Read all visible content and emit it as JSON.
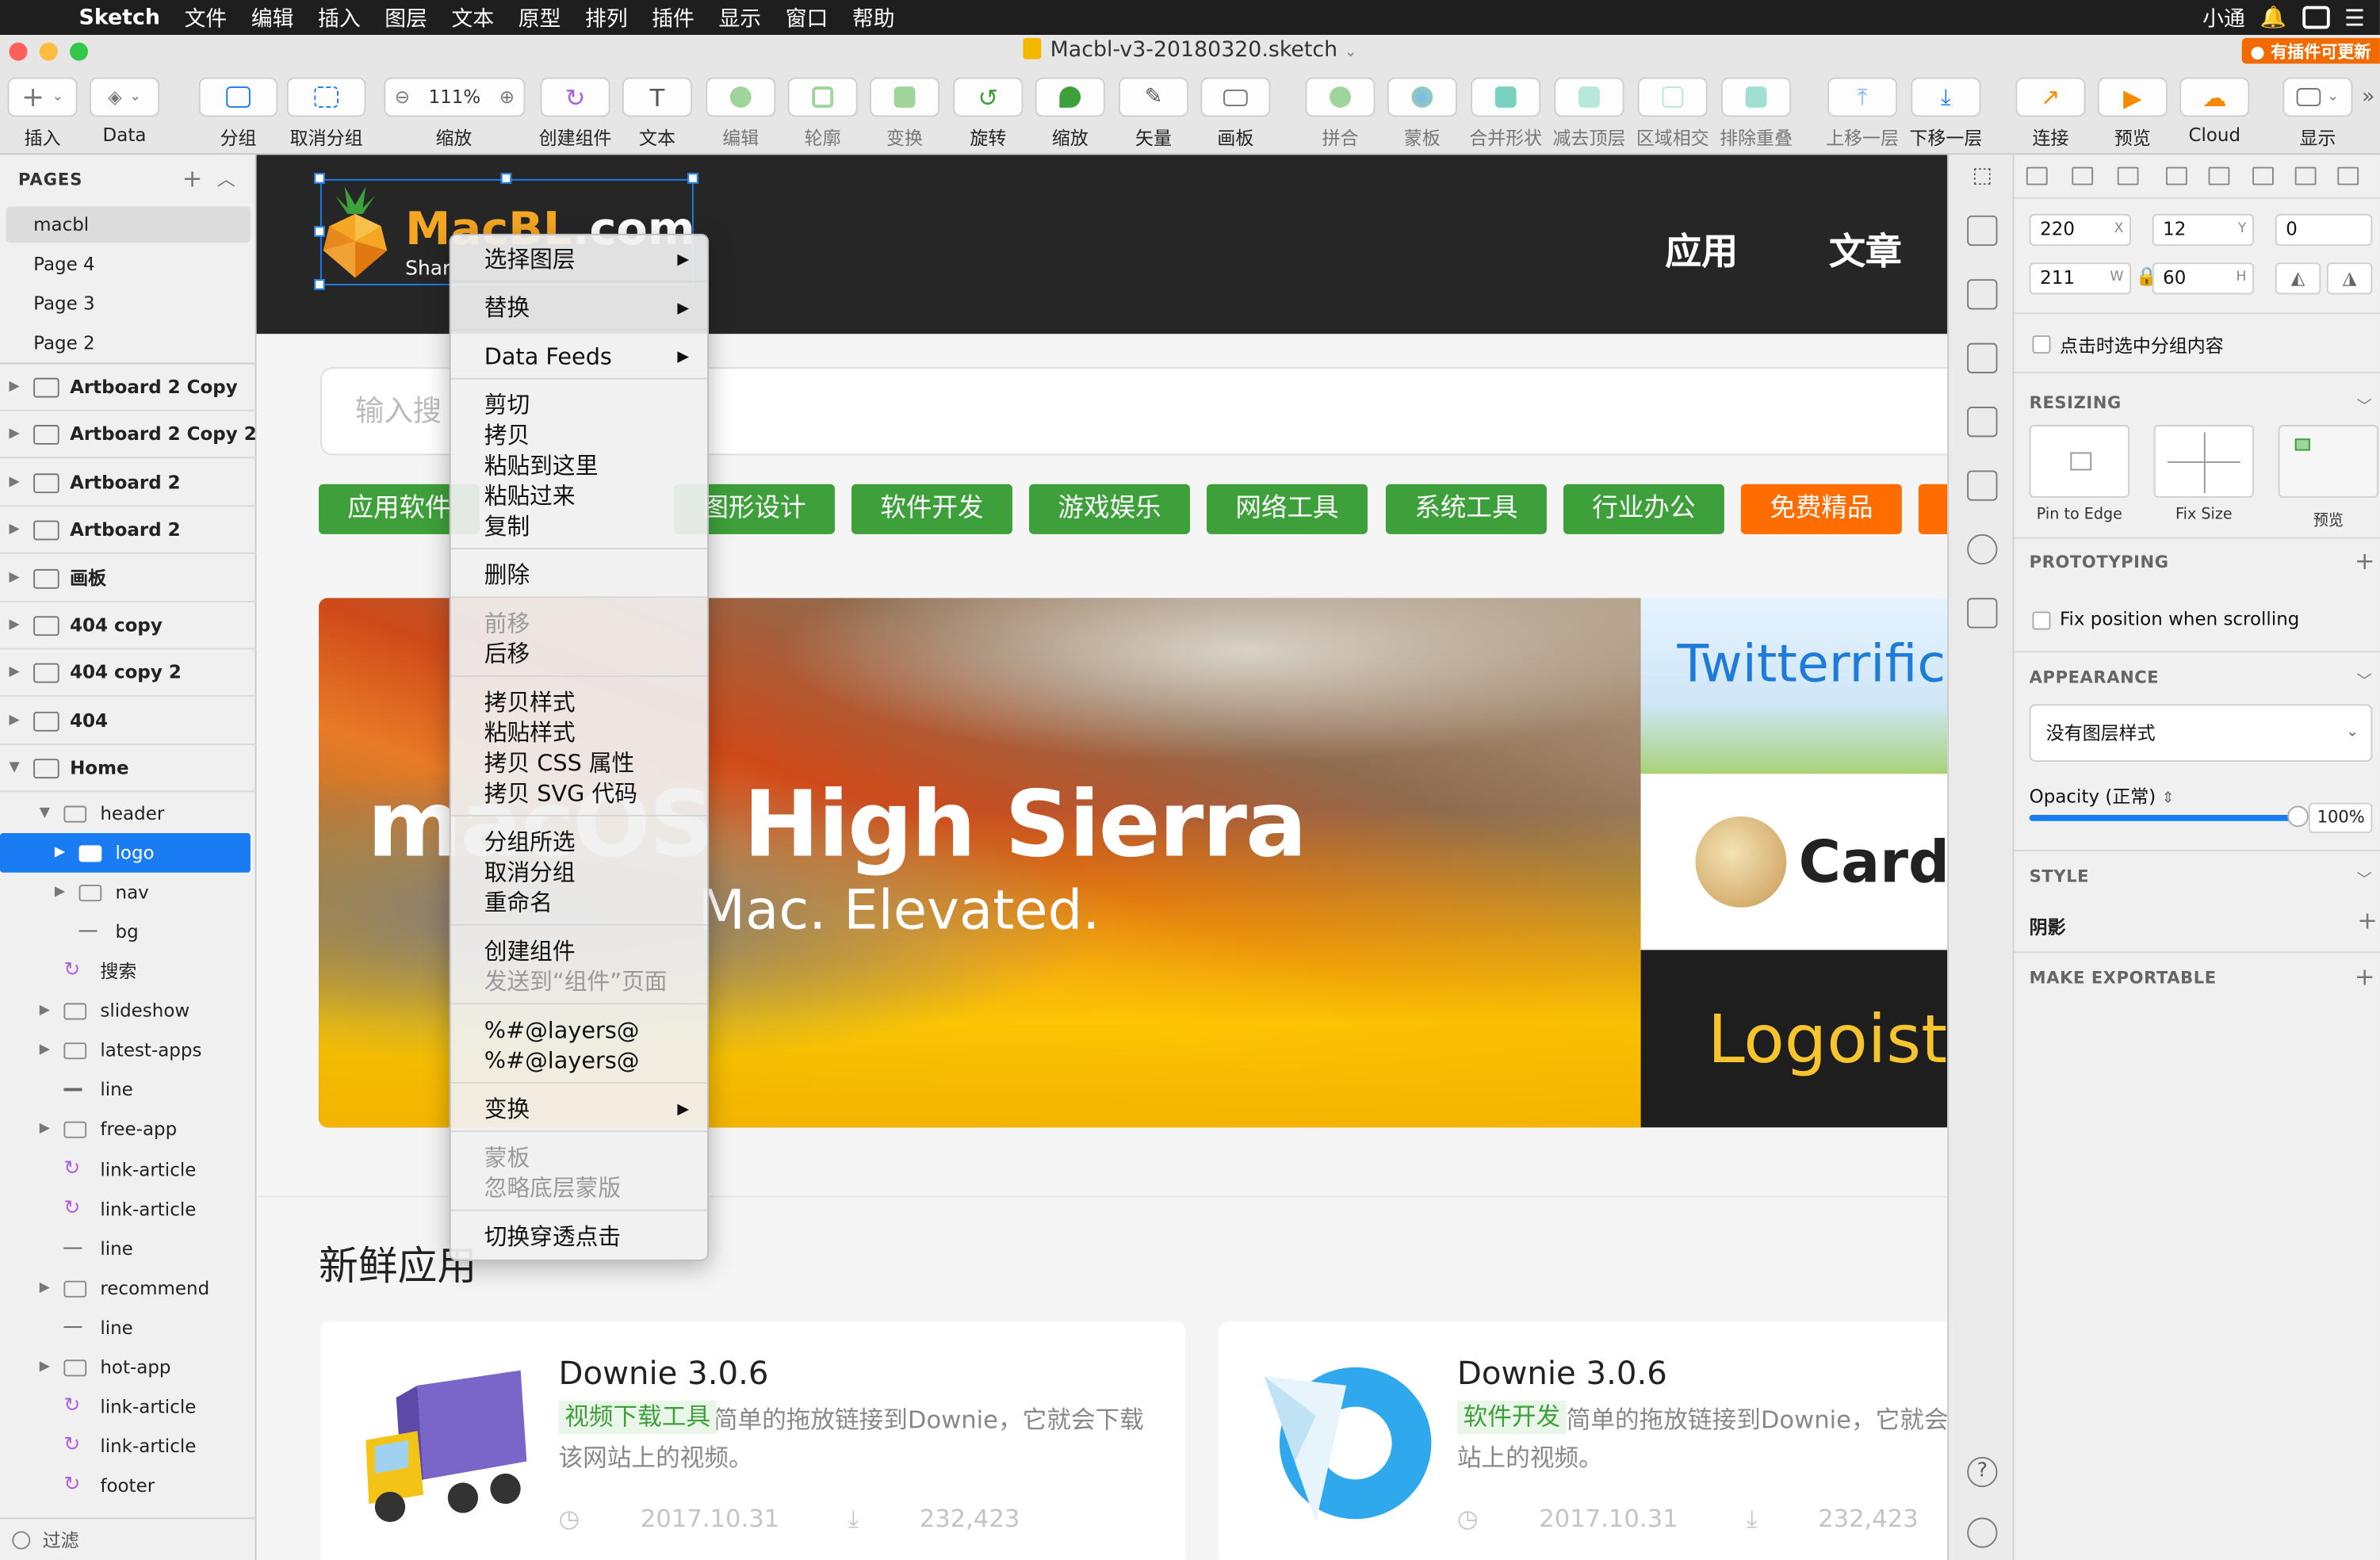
{
  "menubar": {
    "app": "Sketch",
    "items": [
      "文件",
      "编辑",
      "插入",
      "图层",
      "文本",
      "原型",
      "排列",
      "插件",
      "显示",
      "窗口",
      "帮助"
    ],
    "user": "小通"
  },
  "window": {
    "title": "Macbl-v3-20180320.sketch",
    "update_badge": "有插件可更新"
  },
  "toolbar": {
    "zoom": "111%",
    "items": [
      {
        "label": "插入",
        "icon": "plus-icon",
        "enabled": true
      },
      {
        "label": "Data",
        "icon": "layers-icon",
        "enabled": true
      },
      {
        "label": "分组",
        "icon": "group-icon",
        "enabled": true
      },
      {
        "label": "取消分组",
        "icon": "ungroup-icon",
        "enabled": true
      },
      {
        "label": "缩放",
        "icon": "zoom-icon",
        "enabled": true
      },
      {
        "label": "创建组件",
        "icon": "symbol-icon",
        "enabled": true
      },
      {
        "label": "文本",
        "icon": "text-icon",
        "enabled": true
      },
      {
        "label": "编辑",
        "icon": "edit-icon",
        "enabled": false
      },
      {
        "label": "轮廓",
        "icon": "outline-icon",
        "enabled": false
      },
      {
        "label": "变换",
        "icon": "transform-icon",
        "enabled": false
      },
      {
        "label": "旋转",
        "icon": "rotate-icon",
        "enabled": true
      },
      {
        "label": "缩放",
        "icon": "scale-icon",
        "enabled": true
      },
      {
        "label": "矢量",
        "icon": "vector-icon",
        "enabled": true
      },
      {
        "label": "画板",
        "icon": "artboard-icon",
        "enabled": true
      },
      {
        "label": "拼合",
        "icon": "flatten-icon",
        "enabled": false
      },
      {
        "label": "蒙板",
        "icon": "mask-icon",
        "enabled": false
      },
      {
        "label": "合并形状",
        "icon": "union-icon",
        "enabled": false
      },
      {
        "label": "减去顶层",
        "icon": "subtract-icon",
        "enabled": false
      },
      {
        "label": "区域相交",
        "icon": "intersect-icon",
        "enabled": false
      },
      {
        "label": "排除重叠",
        "icon": "difference-icon",
        "enabled": false
      },
      {
        "label": "上移一层",
        "icon": "forward-icon",
        "enabled": false
      },
      {
        "label": "下移一层",
        "icon": "backward-icon",
        "enabled": true
      },
      {
        "label": "连接",
        "icon": "link-icon",
        "enabled": true
      },
      {
        "label": "预览",
        "icon": "preview-icon",
        "enabled": true
      },
      {
        "label": "Cloud",
        "icon": "cloud-icon",
        "enabled": true
      },
      {
        "label": "显示",
        "icon": "view-icon",
        "enabled": true
      }
    ]
  },
  "pages": {
    "header": "PAGES",
    "items": [
      "macbl",
      "Page 4",
      "Page 3",
      "Page 2"
    ],
    "selected": "macbl"
  },
  "layers": [
    {
      "label": "Artboard 2 Copy",
      "type": "artboard"
    },
    {
      "label": "Artboard 2 Copy 2",
      "type": "artboard"
    },
    {
      "label": "Artboard 2",
      "type": "artboard"
    },
    {
      "label": "Artboard 2",
      "type": "artboard"
    },
    {
      "label": "画板",
      "type": "artboard"
    },
    {
      "label": "404 copy",
      "type": "artboard"
    },
    {
      "label": "404 copy 2",
      "type": "artboard"
    },
    {
      "label": "404",
      "type": "artboard"
    },
    {
      "label": "Home",
      "type": "artboard"
    },
    {
      "label": "header",
      "type": "group"
    },
    {
      "label": "logo",
      "type": "group"
    },
    {
      "label": "nav",
      "type": "group"
    },
    {
      "label": "bg",
      "type": "line"
    },
    {
      "label": "搜索",
      "type": "symbol"
    },
    {
      "label": "slideshow",
      "type": "group"
    },
    {
      "label": "latest-apps",
      "type": "group"
    },
    {
      "label": "line",
      "type": "line"
    },
    {
      "label": "free-app",
      "type": "group"
    },
    {
      "label": "link-article",
      "type": "symbol"
    },
    {
      "label": "link-article",
      "type": "symbol"
    },
    {
      "label": "line",
      "type": "line"
    },
    {
      "label": "recommend",
      "type": "group"
    },
    {
      "label": "line",
      "type": "line"
    },
    {
      "label": "hot-app",
      "type": "group"
    },
    {
      "label": "link-article",
      "type": "symbol"
    },
    {
      "label": "link-article",
      "type": "symbol"
    },
    {
      "label": "footer",
      "type": "symbol"
    }
  ],
  "filter": "过滤",
  "site": {
    "logo_text_a": "MacBL",
    "logo_text_b": ".com",
    "logo_sub": "Shar",
    "nav": [
      "应用",
      "文章"
    ],
    "search_placeholder": "输入搜",
    "categories": [
      "应用软件",
      "图形设计",
      "软件开发",
      "游戏娱乐",
      "网络工具",
      "系统工具",
      "行业办公",
      "免费精品"
    ],
    "banner_title": "macOS High Sierra",
    "banner_sub": "Mac. Elevated.",
    "side_cards": [
      "Twitterrific",
      "Cardhop",
      "Logoist"
    ],
    "section_title": "新鲜应用",
    "apps": [
      {
        "name": "Downie 3.0.6",
        "tag": "视频下载工具",
        "desc": "简单的拖放链接到Downie，它就会下载该网站上的视频。",
        "date": "2017.10.31",
        "downloads": "232,423"
      },
      {
        "name": "Downie 3.0.6",
        "tag": "软件开发",
        "desc": "简单的拖放链接到Downie，它就会下载该网站上的视频。",
        "date": "2017.10.31",
        "downloads": "232,423"
      }
    ]
  },
  "context_menu": {
    "groups": [
      [
        {
          "label": "选择图层",
          "submenu": true
        }
      ],
      [
        {
          "label": "替换",
          "submenu": true
        }
      ],
      [
        {
          "label": "Data Feeds",
          "submenu": true
        }
      ],
      [
        {
          "label": "剪切"
        },
        {
          "label": "拷贝"
        },
        {
          "label": "粘贴到这里"
        },
        {
          "label": "粘贴过来"
        },
        {
          "label": "复制"
        }
      ],
      [
        {
          "label": "删除"
        }
      ],
      [
        {
          "label": "前移",
          "disabled": true
        },
        {
          "label": "后移"
        }
      ],
      [
        {
          "label": "拷贝样式"
        },
        {
          "label": "粘贴样式"
        },
        {
          "label": "拷贝 CSS 属性"
        },
        {
          "label": "拷贝 SVG 代码"
        }
      ],
      [
        {
          "label": "分组所选"
        },
        {
          "label": "取消分组"
        },
        {
          "label": "重命名"
        }
      ],
      [
        {
          "label": "创建组件"
        },
        {
          "label": "发送到“组件”页面",
          "disabled": true
        }
      ],
      [
        {
          "label": "%#@layers@"
        },
        {
          "label": "%#@layers@"
        }
      ],
      [
        {
          "label": "变换",
          "submenu": true
        }
      ],
      [
        {
          "label": "蒙板",
          "disabled": true
        },
        {
          "label": "忽略底层蒙版",
          "disabled": true
        }
      ],
      [
        {
          "label": "切换穿透点击"
        }
      ]
    ]
  },
  "inspector": {
    "x": "220",
    "x_lbl": "X",
    "y": "12",
    "y_lbl": "Y",
    "rotation": "0",
    "w": "211",
    "w_lbl": "W",
    "h": "60",
    "h_lbl": "H",
    "click_select": "点击时选中分组内容",
    "resizing": "RESIZING",
    "resizing_opts": [
      "Pin to Edge",
      "Fix Size",
      "预览"
    ],
    "prototyping": "PROTOTYPING",
    "fix_position": "Fix position when scrolling",
    "appearance": "APPEARANCE",
    "layer_style": "没有图层样式",
    "opacity_label": "Opacity (正常)",
    "opacity": "100%",
    "opacity_value": 1.0,
    "style": "STYLE",
    "shadow": "阴影",
    "make_exportable": "MAKE EXPORTABLE"
  },
  "colors": {
    "accent": "#1a7cf2",
    "category_green": "#3ea03a",
    "category_orange": "#ff6d00",
    "logo_orange": "#f5a623"
  }
}
